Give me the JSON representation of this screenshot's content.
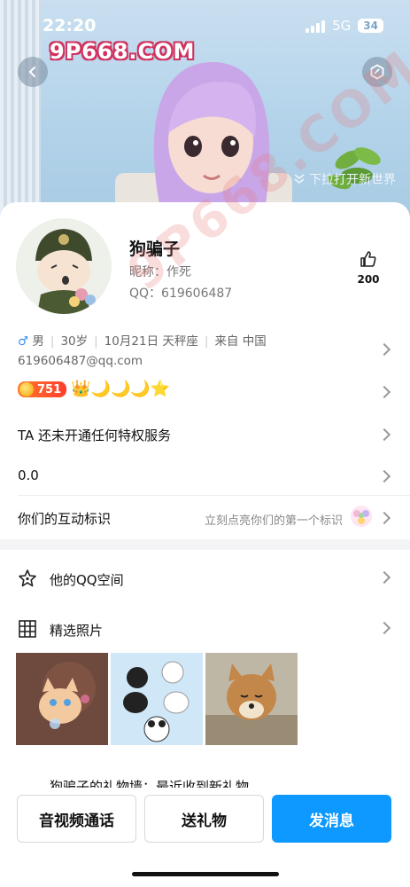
{
  "status": {
    "time": "22:20",
    "network": "5G",
    "battery": "34"
  },
  "cover": {
    "watermark": "9P668.COM",
    "pull_hint": "下拉打开新世界"
  },
  "profile": {
    "name": "狗骗子",
    "nickname": "昵称：作死",
    "qq": "QQ：619606487",
    "likes": "200"
  },
  "info": {
    "gender": "♂",
    "gender_label": "男",
    "age": "30岁",
    "birthday": "10月21日 天秤座",
    "from": "来自 中国",
    "email": "619606487@qq.com"
  },
  "badges": {
    "coins": "751",
    "level_icons": "👑🌙🌙🌙⭐"
  },
  "rows": {
    "privilege": "TA 还未开通任何特权服务",
    "value": "0.0",
    "interaction": "你们的互动标识",
    "interaction_hint": "立刻点亮你们的第一个标识"
  },
  "menu": {
    "qzone": "他的QQ空间",
    "photos": "精选照片",
    "gift_wall": "狗骗子的礼物墙：最近收到新礼物"
  },
  "actions": {
    "call": "音视频通话",
    "gift": "送礼物",
    "message": "发消息"
  },
  "colors": {
    "primary": "#0d99ff",
    "coin": "#ff5a2a",
    "watermark": "#d0325f"
  }
}
